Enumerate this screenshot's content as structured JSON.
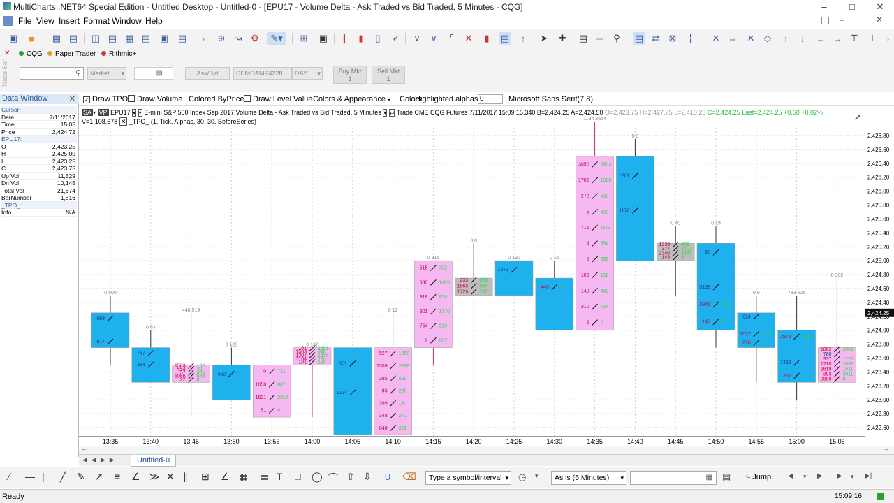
{
  "window": {
    "title": "MultiCharts .NET64 Special Edition - Untitled Desktop - Untitled-0 - [EPU17 - Volume Delta - Ask Traded vs Bid Traded, 5 Minutes - CQG]"
  },
  "menu": [
    "File",
    "View",
    "Insert",
    "Format",
    "Window",
    "Help"
  ],
  "accounts": [
    {
      "label": "CQG",
      "color": "#2ca02c"
    },
    {
      "label": "Paper Trader",
      "color": "#e0a020"
    },
    {
      "label": "Rithmic+",
      "color": "#d23a3a"
    }
  ],
  "tradebar": {
    "order_type": "Market",
    "askbid": "Ask/Bid",
    "account": "DEMOAMP4228",
    "tif": "DAY",
    "buy_label": "Buy Mkt",
    "buy_qty": "1",
    "sell_label": "Sell Mkt",
    "sell_qty": "1",
    "vertical_label": "Trade Bar"
  },
  "datawindow": {
    "title": "Data Window",
    "rows": [
      {
        "k": "Cursor:",
        "v": "",
        "head": true
      },
      {
        "k": "Date",
        "v": "7/11/2017"
      },
      {
        "k": "Time",
        "v": "15:05"
      },
      {
        "k": "Price",
        "v": "2,424.72"
      },
      {
        "k": "EPU17:",
        "v": "",
        "head": true
      },
      {
        "k": "O",
        "v": "2,423.25"
      },
      {
        "k": "H",
        "v": "2,425.00"
      },
      {
        "k": "L",
        "v": "2,423.25"
      },
      {
        "k": "C",
        "v": "2,423.75"
      },
      {
        "k": "Up Vol",
        "v": "11,529"
      },
      {
        "k": "Dn Vol",
        "v": "10,145"
      },
      {
        "k": "Total Vol",
        "v": "21,674"
      },
      {
        "k": "BarNumber",
        "v": "1,816"
      },
      {
        "k": "_TPO_:",
        "v": "",
        "head": true
      },
      {
        "k": "Info",
        "v": "N/A"
      }
    ]
  },
  "charttoolbar": {
    "draw_tpo": "Draw TPO",
    "draw_volume": "Draw Volume",
    "colored_by_price": "Colored ByPrice",
    "draw_level_value": "Draw Level Value",
    "colors_appearance": "Colors & Appearance",
    "colors": "Colors",
    "highlighted_alphas": "Highlighted alphas",
    "alpha_value": "0",
    "font": "Microsoft Sans Serif(7.8)"
  },
  "legend": {
    "sa": "SA",
    "vp": "VP",
    "symbol": "EPU17",
    "description": "E-mini S&P 500 Index Sep 2017  Volume Delta - Ask Traded vs Bid Traded, 5 Minutes",
    "trade": "Trade  CME  CQG  Futures  7/11/2017  15:09:15.340  B=2,424.25  A=2,424.50",
    "ohlc": "O=2,423.75  H=2,427.75  L=2,410.25",
    "last": "C=2,424.25  Last=2,424.25  +0.50  +0.02%",
    "vline": "V=1,108,678",
    "study": "_TPO_  (1,  Tick,  Alphas,  30,  30,  BeforeSeries)"
  },
  "chart_data": {
    "type": "candlestick",
    "ylim": [
      2422.5,
      2427.0
    ],
    "yticks": [
      "2,426.80",
      "2,426.60",
      "2,426.40",
      "2,426.20",
      "2,426.00",
      "2,425.80",
      "2,425.60",
      "2,425.40",
      "2,425.20",
      "2,425.00",
      "2,424.80",
      "2,424.60",
      "2,424.40",
      "2,424.20",
      "2,424.00",
      "2,423.80",
      "2,423.60",
      "2,423.40",
      "2,423.20",
      "2,423.00",
      "2,422.80",
      "2,422.60"
    ],
    "ytick_values": [
      2426.8,
      2426.6,
      2426.4,
      2426.2,
      2426.0,
      2425.8,
      2425.6,
      2425.4,
      2425.2,
      2425.0,
      2424.8,
      2424.6,
      2424.4,
      2424.2,
      2424.0,
      2423.8,
      2423.6,
      2423.4,
      2423.2,
      2423.0,
      2422.8,
      2422.6
    ],
    "xlabels": [
      "13:35",
      "13:40",
      "13:45",
      "13:50",
      "13:55",
      "14:00",
      "14:05",
      "14:10",
      "14:15",
      "14:20",
      "14:25",
      "14:30",
      "14:35",
      "14:40",
      "14:45",
      "14:50",
      "14:55",
      "15:00",
      "15:05"
    ],
    "last_price_label": "2,424.25",
    "bars": [
      {
        "o": 2424.25,
        "c": 2423.75,
        "h": 2424.5,
        "l": 2423.5,
        "lo": "54",
        "lv": "0",
        "top": "0 500",
        "vals": [
          "668",
          "",
          "817"
        ]
      },
      {
        "o": 2423.75,
        "c": 2423.25,
        "h": 2424.0,
        "l": 2423.25,
        "top": "0 63",
        "vals": [
          "757",
          "334",
          ""
        ]
      },
      {
        "o": 2423.25,
        "c": 2423.5,
        "h": 2424.25,
        "l": 2422.75,
        "top": "448 519",
        "vals": [
          "1583 182",
          "554 30",
          "57 405",
          "1066 663",
          "22 0"
        ]
      },
      {
        "o": 2423.5,
        "c": 2423.0,
        "h": 2423.75,
        "l": 2423.0,
        "top": "0 128",
        "vals": [
          "452",
          ""
        ]
      },
      {
        "o": 2422.75,
        "c": 2423.5,
        "h": 2423.5,
        "l": 2422.75,
        "top": "",
        "vals": [
          "0 721",
          "1058 847",
          "1621 2012",
          "51 0"
        ]
      },
      {
        "o": 2423.5,
        "c": 2423.75,
        "h": 2423.75,
        "l": 2422.75,
        "top": "0 137",
        "vals": [
          "181 1881",
          "1503 940",
          "1207 1659",
          "1104 120",
          "101 120"
        ]
      },
      {
        "o": 2423.75,
        "c": 2422.5,
        "h": 2423.75,
        "l": 2422.5,
        "top": "",
        "vals": [
          "851",
          "1224",
          ""
        ]
      },
      {
        "o": 2422.5,
        "c": 2423.75,
        "h": 2424.25,
        "l": 2422.5,
        "top": "0 12",
        "vals": [
          "527 1058",
          "1309 2318",
          "385 882",
          "93 283",
          "399 13",
          "348 270",
          "840 361"
        ]
      },
      {
        "o": 2423.75,
        "c": 2425.0,
        "h": 2425.0,
        "l": 2423.5,
        "top": "0 316",
        "vals": [
          "515 702",
          "330 1426",
          "318 850",
          "901 1770",
          "754 329",
          "2 907"
        ]
      },
      {
        "o": 2424.75,
        "c": 2424.5,
        "h": 2425.25,
        "l": 2424.5,
        "top": "0 0",
        "vals": [
          "233 666",
          "1563 597",
          "1726 762"
        ]
      },
      {
        "o": 2425.0,
        "c": 2424.5,
        "h": 2425.0,
        "l": 2424.5,
        "top": "0 190",
        "vals": [
          "1072",
          ""
        ]
      },
      {
        "o": 2424.75,
        "c": 2424.0,
        "h": 2425.0,
        "l": 2424.0,
        "top": "0 16",
        "vals": [
          "440 0",
          "",
          ""
        ]
      },
      {
        "o": 2424.0,
        "c": 2426.5,
        "h": 2427.0,
        "l": 2424.0,
        "top": "1134 2654",
        "vals": [
          "3050 2803",
          "1702 1928",
          "272 532",
          "5 602",
          "716 1172",
          "4 854",
          "5 892",
          "100 192",
          "140 432",
          "310 704",
          "2 0"
        ]
      },
      {
        "o": 2426.5,
        "c": 2425.0,
        "h": 2426.75,
        "l": 2425.0,
        "top": "0 0",
        "vals": [
          "1261",
          "1170",
          ""
        ]
      },
      {
        "o": 2425.25,
        "c": 2425.0,
        "h": 2425.5,
        "l": 2424.5,
        "top": "0 40",
        "vals": [
          "1239 909",
          "377 1703",
          "2346 1443",
          "143 0"
        ]
      },
      {
        "o": 2425.25,
        "c": 2424.0,
        "h": 2425.5,
        "l": 2423.75,
        "top": "0 19",
        "vals": [
          "80",
          "",
          "3168",
          "3941 1621",
          "147 0"
        ]
      },
      {
        "o": 2424.25,
        "c": 2423.75,
        "h": 2424.5,
        "l": 2423.25,
        "top": "0 9",
        "vals": [
          "624",
          "",
          "2022 1305",
          "276 0"
        ]
      },
      {
        "o": 2424.0,
        "c": 2423.25,
        "h": 2424.5,
        "l": 2423.0,
        "top": "783 625",
        "vals": [
          "2876 2997",
          "",
          "7432",
          "367 0"
        ]
      },
      {
        "o": 2423.25,
        "c": 2423.75,
        "h": 2424.75,
        "l": 2423.25,
        "top": "0 302",
        "vals": [
          "1862 2561",
          "780",
          "337 1721",
          "1210 2033",
          "2619 1611",
          "393 3011",
          "2890 0"
        ]
      }
    ]
  },
  "tabs": {
    "sheet": "Untitled-0"
  },
  "drawtoolbar": {
    "symbol_placeholder": "Type a symbol/interval",
    "resolution": "As is (5 Minutes)",
    "jump": "Jump"
  },
  "status": {
    "left": "Ready",
    "time": "15:09:16"
  },
  "colors": {
    "up": "#f5b8f0",
    "down": "#1fb0ee",
    "neutral": "#bdbdbd",
    "up_text": "#2bd94a",
    "dn_text": "#c8003a"
  }
}
